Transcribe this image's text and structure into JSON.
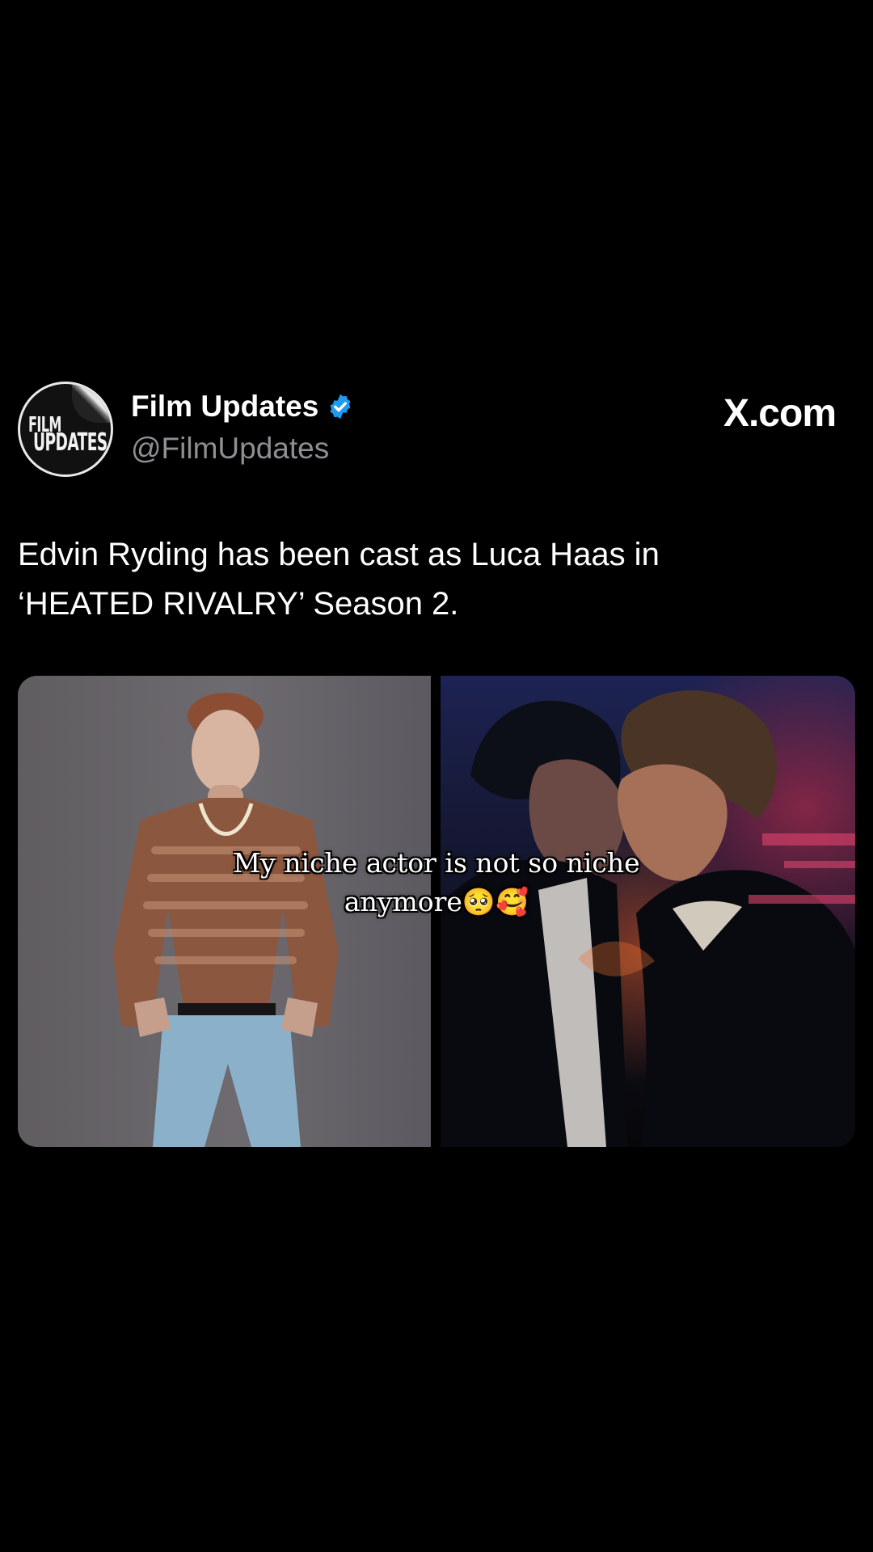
{
  "post": {
    "account": {
      "name": "Film Updates",
      "handle": "@FilmUpdates",
      "avatar_text": [
        "FILM",
        "UPDATES"
      ],
      "verified": true,
      "verified_icon": "verified-check-icon",
      "verified_color": "#1d9bf0"
    },
    "source_logo": "X.com",
    "text_lines": [
      "Edvin Ryding has been cast as Luca Haas in",
      "‘HEATED RIVALRY’ Season 2."
    ],
    "media": {
      "left_image": "actor-portrait-photo",
      "right_image": "tuxedo-couple-scene-photo"
    }
  },
  "overlay_caption": {
    "line1": "My niche actor is not so niche",
    "line2": "anymore🥺🥰"
  },
  "colors": {
    "background": "#000000",
    "text_primary": "#ffffff",
    "text_secondary": "#8d8f93",
    "verified_blue": "#1d9bf0"
  }
}
